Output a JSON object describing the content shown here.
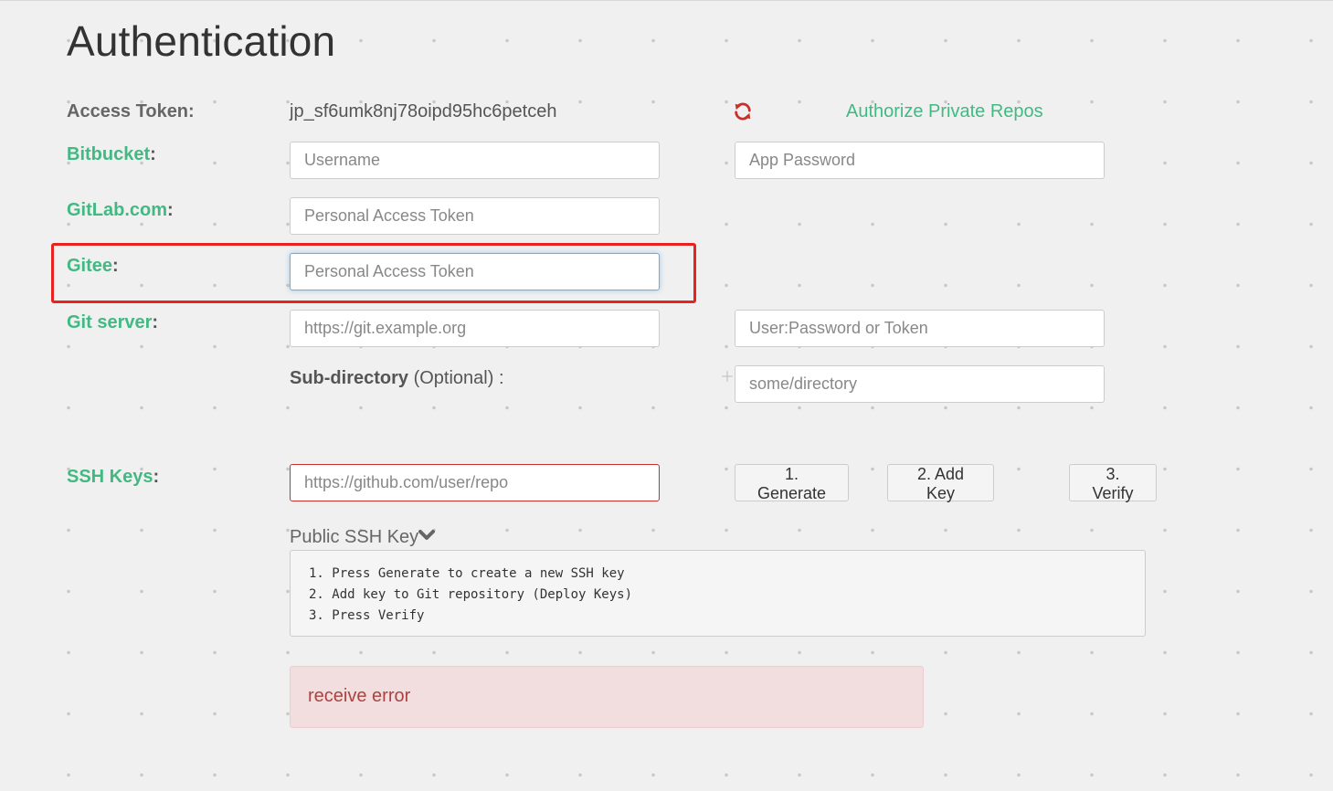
{
  "title": "Authentication",
  "access_token": {
    "label": "Access Token:",
    "value": "jp_sf6umk8nj78oipd95hc6petceh",
    "refresh_icon": "refresh-icon",
    "authorize_link": "Authorize Private Repos"
  },
  "bitbucket": {
    "label": "Bitbucket",
    "username_placeholder": "Username",
    "password_placeholder": "App Password"
  },
  "gitlab": {
    "label": "GitLab.com",
    "token_placeholder": "Personal Access Token"
  },
  "gitee": {
    "label": "Gitee",
    "token_placeholder": "Personal Access Token"
  },
  "git_server": {
    "label": "Git server",
    "url_placeholder": "https://git.example.org",
    "credentials_placeholder": "User:Password or Token",
    "subdir_label_bold": "Sub-directory",
    "subdir_label_rest": " (Optional) :",
    "subdir_placeholder": "some/directory"
  },
  "ssh": {
    "label": "SSH Keys",
    "repo_placeholder": "https://github.com/user/repo",
    "buttons": [
      "1. Generate",
      "2. Add Key",
      "3. Verify"
    ],
    "public_key_label": "Public SSH Key",
    "instructions": [
      "1. Press Generate to create a new SSH key",
      "2. Add key to Git repository (Deploy Keys)",
      "3. Press Verify"
    ]
  },
  "error_message": "receive error",
  "colors": {
    "accent": "#42b983",
    "error_text": "#a94442",
    "error_bg": "#f2dede",
    "highlight": "#e8231f",
    "refresh_icon": "#c9302c"
  }
}
